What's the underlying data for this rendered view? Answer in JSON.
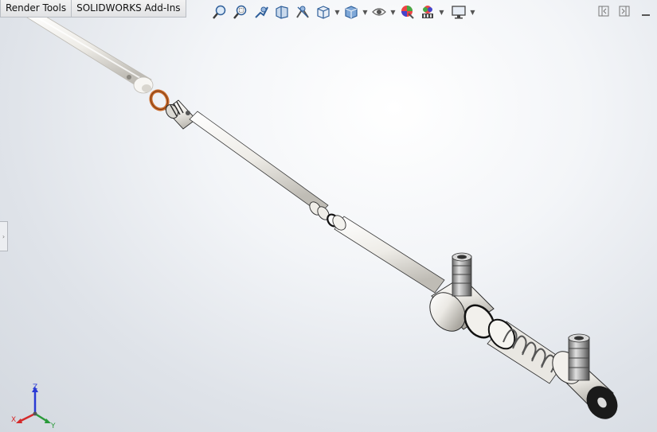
{
  "tabs": [
    {
      "label": "Render Tools"
    },
    {
      "label": "SOLIDWORKS Add-Ins"
    }
  ],
  "toolbar": {
    "buttons": [
      {
        "icon": "zoom-to-fit-icon"
      },
      {
        "icon": "zoom-to-area-icon"
      },
      {
        "icon": "previous-view-icon"
      },
      {
        "icon": "section-view-icon"
      },
      {
        "icon": "dynamic-annotation-icon"
      },
      {
        "icon": "view-orientation-icon"
      },
      {
        "icon": "display-style-icon"
      },
      {
        "icon": "hide-show-items-icon"
      },
      {
        "icon": "edit-appearance-icon"
      },
      {
        "icon": "apply-scene-icon"
      },
      {
        "icon": "view-settings-icon"
      }
    ]
  },
  "triad": {
    "x_label": "X",
    "y_label": "Y",
    "z_label": "Z",
    "colors": {
      "x": "#d42a2a",
      "y": "#2a9a3a",
      "z": "#2a3ad4"
    }
  },
  "colors": {
    "part_fill": "#f1efea",
    "part_shade": "#c9c6bf",
    "oring": "#c86a2b",
    "outline": "#2a2a2a"
  }
}
